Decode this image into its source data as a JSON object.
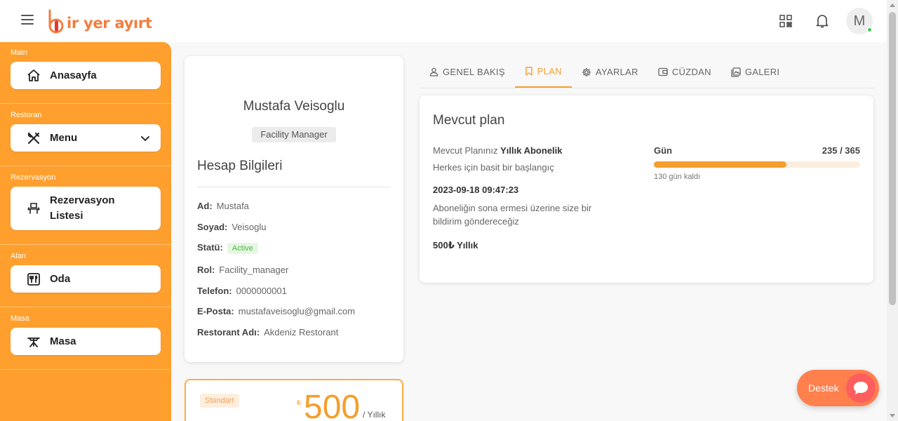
{
  "app": {
    "logo_text": "ir yer ayırt",
    "avatar_initial": "M"
  },
  "icons": {
    "menu": "hamburger-icon",
    "qr": "qr-code-icon",
    "bell": "bell-icon"
  },
  "sidebar": {
    "sections": [
      {
        "label": "Main",
        "item": "Anasayfa",
        "icon": "home-icon"
      },
      {
        "label": "Restoran",
        "item": "Menu",
        "icon": "utensils-icon",
        "expandable": true
      },
      {
        "label": "Rezervasyon",
        "item_line1": "Rezervasyon",
        "item_line2": "Listesi",
        "icon": "chair-icon"
      },
      {
        "label": "Alan",
        "item": "Oda",
        "icon": "room-icon"
      },
      {
        "label": "Masa",
        "item": "Masa",
        "icon": "table-icon"
      }
    ]
  },
  "profile": {
    "name": "Mustafa Veisoglu",
    "role": "Facility Manager",
    "heading": "Hesap Bilgileri",
    "fields": [
      {
        "key": "Ad:",
        "value": "Mustafa"
      },
      {
        "key": "Soyad:",
        "value": "Veisoglu"
      },
      {
        "key": "Statü:",
        "value": "Active"
      },
      {
        "key": "Rol:",
        "value": "Facility_manager"
      },
      {
        "key": "Telefon:",
        "value": "0000000001"
      },
      {
        "key": "E-Posta:",
        "value": "mustafaveisoglu@gmail.com"
      },
      {
        "key": "Restorant Adı:",
        "value": "Akdeniz Restorant"
      }
    ]
  },
  "plan_card": {
    "badge": "Standart",
    "currency": "₺",
    "price": "500",
    "period": "/ Yıllık"
  },
  "tabs": [
    {
      "label": "GENEL BAKIŞ",
      "icon": "user-icon",
      "active": false
    },
    {
      "label": "PLAN",
      "icon": "bookmark-icon",
      "active": true
    },
    {
      "label": "AYARLAR",
      "icon": "gear-icon",
      "active": false
    },
    {
      "label": "CÜZDAN",
      "icon": "wallet-icon",
      "active": false
    },
    {
      "label": "GALERI",
      "icon": "gallery-icon",
      "active": false
    }
  ],
  "current_plan": {
    "title": "Mevcut plan",
    "plan_prefix": "Mevcut Planınız",
    "plan_name": "Yıllık Abonelik",
    "tagline": "Herkes için basit bir başlangıç",
    "date": "2023-09-18 09:47:23",
    "note": "Aboneliğin sona ermesi üzerine size bir bildirim göndereceğiz",
    "price": "500₺ Yıllık",
    "days_label": "Gün",
    "days_count": "235 / 365",
    "progress": 0.644,
    "remaining": "130 gün kaldı"
  },
  "support": {
    "label": "Destek",
    "icon": "chat-bubble-icon"
  },
  "colors": {
    "accent": "#ff9f2e",
    "brand": "#f47d3c",
    "active_tab": "#f3a035",
    "support": "#ff7f4d",
    "status_active": "#45b83a"
  }
}
